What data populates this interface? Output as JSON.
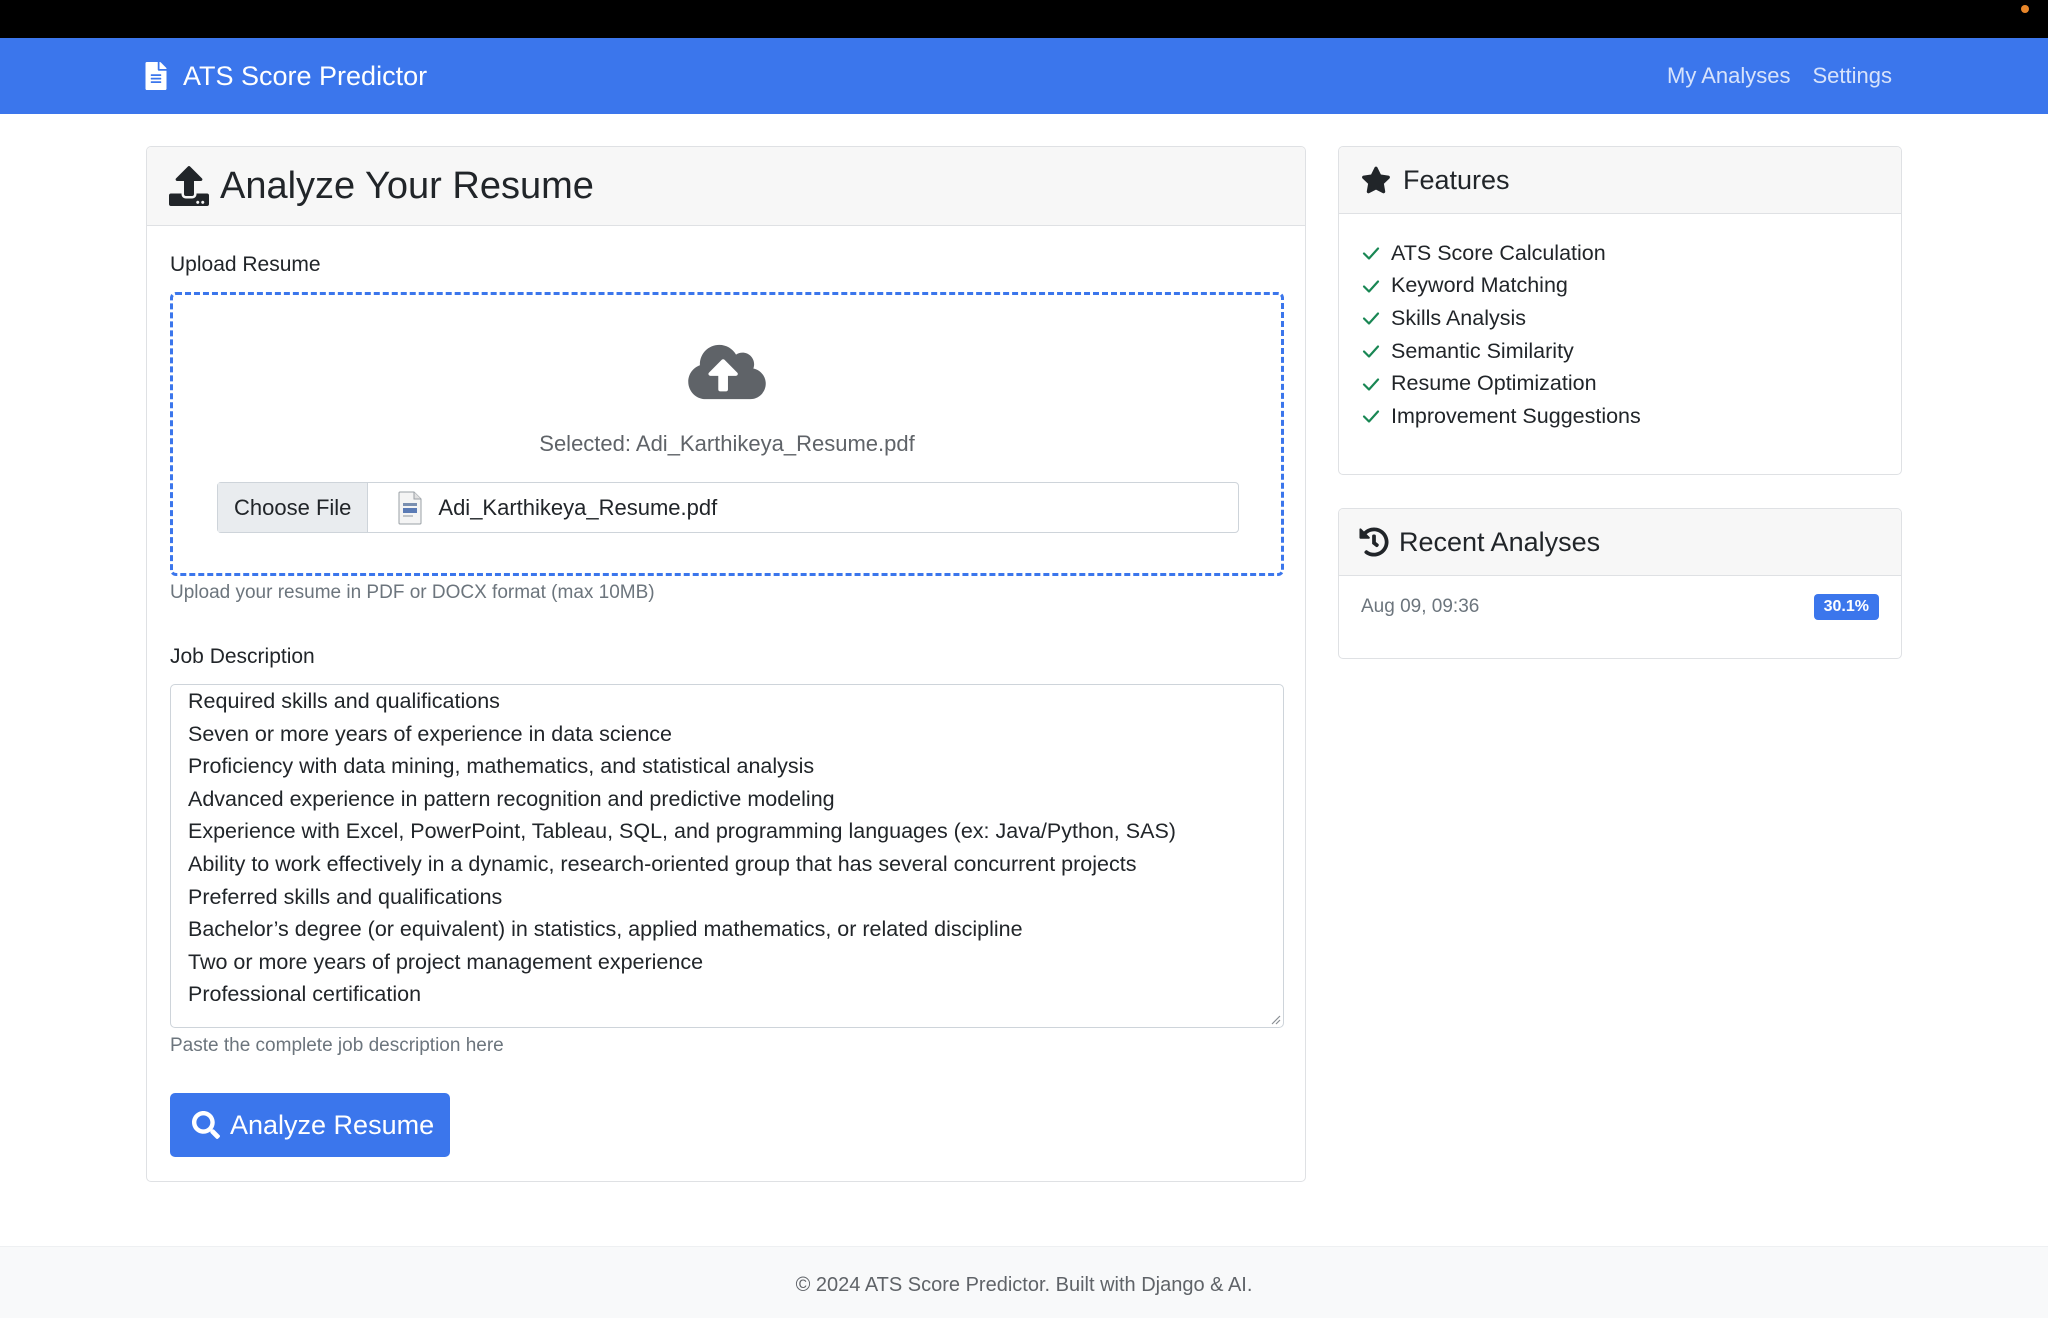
{
  "navbar": {
    "brand": "ATS Score Predictor",
    "links": [
      "My Analyses",
      "Settings"
    ]
  },
  "upload_card": {
    "title": "Analyze Your Resume",
    "upload_label": "Upload Resume",
    "selected_text": "Selected: Adi_Karthikeya_Resume.pdf",
    "choose_file_label": "Choose File",
    "file_name": "Adi_Karthikeya_Resume.pdf",
    "upload_help": "Upload your resume in PDF or DOCX format (max 10MB)",
    "jd_label": "Job Description",
    "jd_lines": [
      "Required skills and qualifications",
      "Seven or more years of experience in data science",
      "Proficiency with data mining, mathematics, and statistical analysis",
      "Advanced experience in pattern recognition and predictive modeling",
      "Experience with Excel, PowerPoint, Tableau, SQL, and programming languages (ex: Java/Python, SAS)",
      "Ability to work effectively in a dynamic, research-oriented group that has several concurrent projects",
      "Preferred skills and qualifications",
      "Bachelor’s degree (or equivalent) in statistics, applied mathematics, or related discipline",
      "Two or more years of project management experience",
      "Professional certification"
    ],
    "jd_help": "Paste the complete job description here",
    "analyze_label": "Analyze Resume"
  },
  "features": {
    "title": "Features",
    "items": [
      "ATS Score Calculation",
      "Keyword Matching",
      "Skills Analysis",
      "Semantic Similarity",
      "Resume Optimization",
      "Improvement Suggestions"
    ]
  },
  "recent": {
    "title": "Recent Analyses",
    "items": [
      {
        "date": "Aug 09, 09:36",
        "score": "30.1%"
      }
    ]
  },
  "footer": {
    "text": "© 2024 ATS Score Predictor. Built with Django & AI."
  },
  "colors": {
    "primary": "#3b76ec",
    "success_check": "#198754",
    "muted": "#6c757d"
  }
}
